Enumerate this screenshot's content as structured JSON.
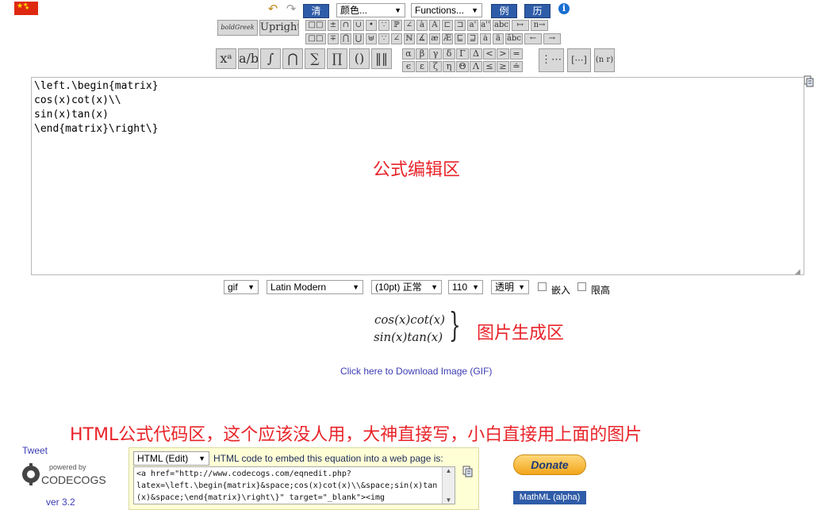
{
  "toolbar": {
    "clear_label": "清除",
    "color_select": "颜色...",
    "functions_select": "Functions...",
    "examples_label": "例子",
    "history_label": "历史",
    "info_glyph": "i",
    "undo_glyph": "↶",
    "redo_glyph": "↷",
    "bold_greek": "boldGreek",
    "upright": "Upright",
    "row1_symbols": [
      "□□",
      "±",
      "∩",
      "∪",
      "•",
      "∵",
      "ℙ",
      "∠",
      "à",
      "A",
      "⊏",
      "⊐",
      "a'",
      "a''",
      "abc",
      "↦",
      "n→"
    ],
    "row2_symbols": [
      "□□",
      "∓",
      "⋂",
      "⋃",
      "⊎",
      "∵",
      "∠",
      "ℕ",
      "∡",
      "æ",
      "Æ",
      "⊑",
      "⊒",
      "ȧ",
      "ä",
      "ãbc",
      "←",
      "→"
    ],
    "big_buttons": [
      "xᵃ",
      "a/b",
      "∫",
      "⋂",
      "∑",
      "∏",
      "()",
      "‖‖"
    ],
    "greek_row1": [
      "α",
      "β",
      "γ",
      "δ",
      "Γ",
      "Δ",
      "<",
      ">",
      "="
    ],
    "greek_row2": [
      "ϵ",
      "ε",
      "ζ",
      "η",
      "Θ",
      "Λ",
      "≤",
      "≥",
      "≐"
    ],
    "matrix_buttons": [
      "⋮⋯",
      "[⋯]",
      "(n r)"
    ]
  },
  "editor": {
    "content": "\\left.\\begin{matrix}\ncos(x)cot(x)\\\\\nsin(x)tan(x)\n\\end{matrix}\\right\\}",
    "annotation": "公式编辑区"
  },
  "options": {
    "format": "gif",
    "font": "Latin Modern",
    "size": "(10pt) 正常",
    "dpi": "110",
    "background": "透明",
    "embed_label": "嵌入",
    "inline_label": "限高"
  },
  "preview": {
    "line1": "cos(x)cot(x)",
    "line2": "sin(x)tan(x)",
    "brace": "}",
    "annotation": "图片生成区",
    "download_link": "Click here to Download Image (GIF)"
  },
  "html_section": {
    "annotation": "HTML公式代码区，这个应该没人用，大神直接写，小白直接用上面的图片",
    "tweet": "Tweet",
    "powered_by": "powered by",
    "brand": "CODECOGS",
    "version": "ver 3.2",
    "mode_select": "HTML (Edit)",
    "description": "HTML code to embed this equation into a web page is:",
    "code": "<a href=\"http://www.codecogs.com/eqnedit.php?\nlatex=\\left.\\begin{matrix}&space;cos(x)cot(x)\\\\&space;sin(x)tan\n(x)&space;\\end{matrix}\\right\\}\" target=\"_blank\"><img",
    "donate": "Donate",
    "mathml": "MathML (alpha)"
  },
  "colors": {
    "accent_blue": "#2f5ca8",
    "annotation_red": "#e8242a",
    "code_panel": "#ffffd6"
  }
}
